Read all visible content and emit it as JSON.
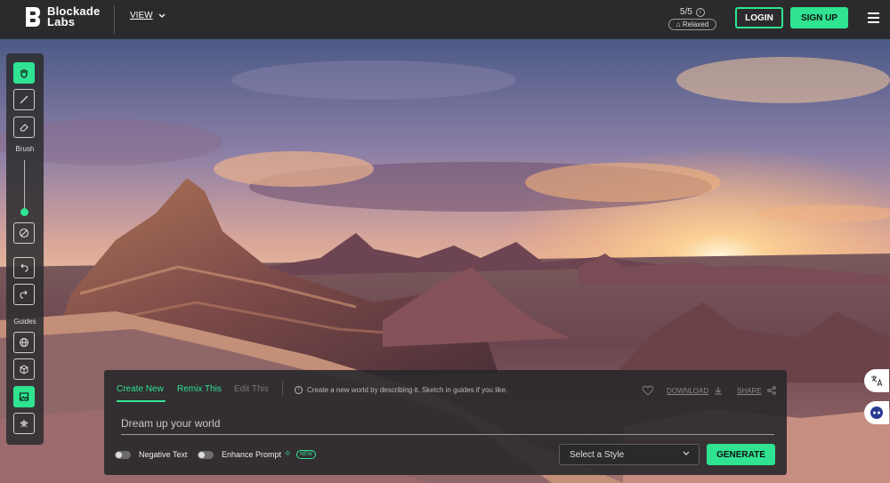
{
  "header": {
    "logo_line1": "Blockade",
    "logo_line2": "Labs",
    "view_label": "VIEW",
    "credits": "5/5",
    "mode_badge": "Relaxed",
    "login_label": "LOGIN",
    "signup_label": "SIGN UP"
  },
  "toolbar": {
    "brush_label": "Brush",
    "guides_label": "Guides",
    "brush_size_level": 0.05
  },
  "panel": {
    "tabs": [
      "Create New",
      "Remix This",
      "Edit This"
    ],
    "hint": "Create a new world by describing it. Sketch in guides if you like.",
    "download_label": "DOWNLOAD",
    "share_label": "SHARE",
    "prompt_placeholder": "Dream up your world",
    "negative_text_label": "Negative Text",
    "enhance_prompt_label": "Enhance Prompt",
    "new_badge": "NEW",
    "style_placeholder": "Select a Style",
    "generate_label": "GENERATE"
  },
  "colors": {
    "accent": "#2fe391",
    "header_bg": "#2b2b2e",
    "panel_bg": "#28282b"
  },
  "icons": [
    "hand-icon",
    "brush-icon",
    "eraser-icon",
    "clear-icon",
    "undo-icon",
    "redo-icon",
    "globe-icon",
    "cube-icon",
    "image-icon",
    "equirect-icon",
    "info-icon",
    "heart-icon",
    "download-icon",
    "share-icon",
    "sparkle-icon",
    "chevron-down-icon",
    "menu-icon",
    "translate-icon",
    "assistant-icon"
  ]
}
